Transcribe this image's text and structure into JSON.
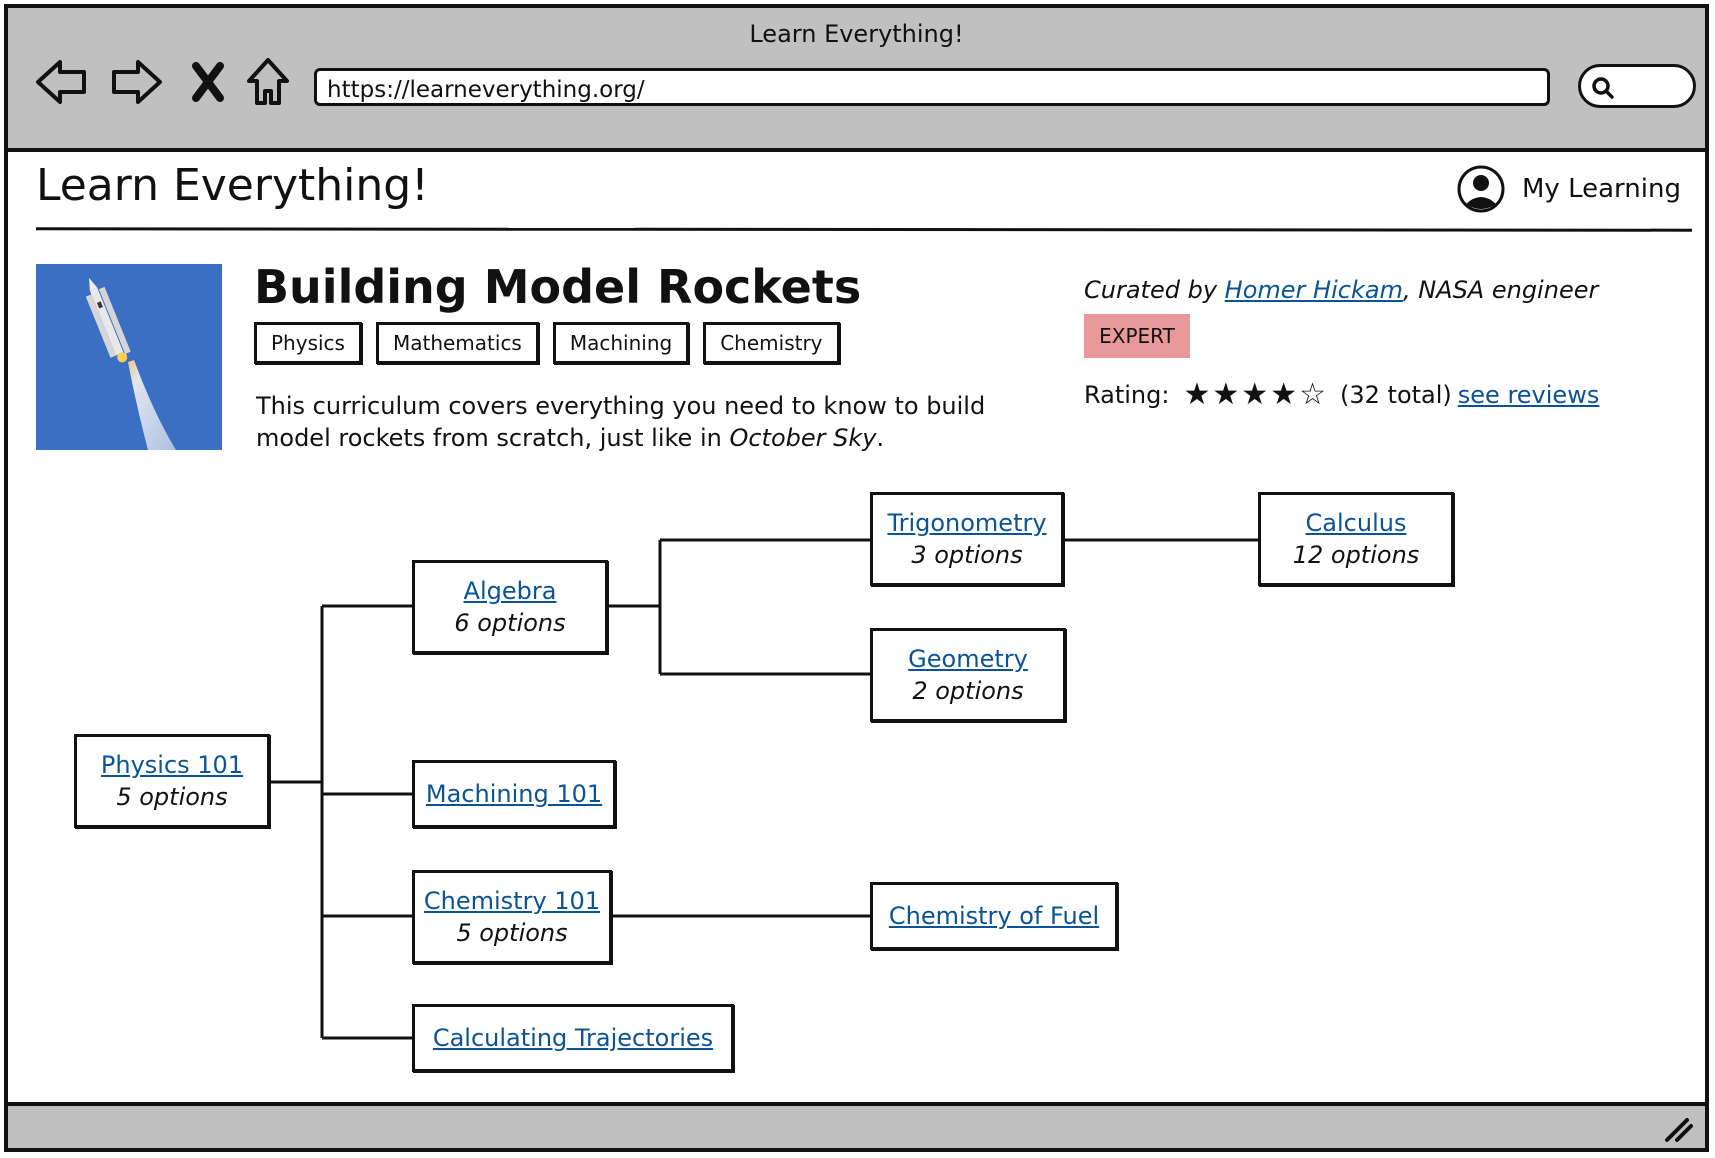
{
  "browser": {
    "window_title": "Learn Everything!",
    "url": "https://learneverything.org/",
    "nav_icons": [
      "back-icon",
      "forward-icon",
      "close-icon",
      "home-icon"
    ],
    "search_icon": "search-icon"
  },
  "header": {
    "site_title": "Learn Everything!",
    "account_label": "My Learning",
    "account_icon": "user-icon"
  },
  "course": {
    "title": "Building Model Rockets",
    "tags": [
      "Physics",
      "Mathematics",
      "Machining",
      "Chemistry"
    ],
    "description_prefix": "This curriculum covers everything you need to know to build model rockets from scratch, just like in ",
    "description_emph": "October Sky",
    "description_suffix": ".",
    "curated_by_label": "Curated by",
    "curator_name": "Homer Hickam",
    "curator_role": ", NASA engineer",
    "level_badge": "EXPERT",
    "level_color": "#e89999",
    "rating_label": "Rating:",
    "rating_value": 4,
    "rating_max": 5,
    "rating_total": "(32 total)",
    "reviews_link": "see reviews"
  },
  "curriculum": {
    "nodes": {
      "physics": {
        "label": "Physics 101",
        "options": "5 options"
      },
      "algebra": {
        "label": "Algebra",
        "options": "6 options"
      },
      "trigonometry": {
        "label": "Trigonometry",
        "options": "3 options"
      },
      "calculus": {
        "label": "Calculus",
        "options": "12 options"
      },
      "geometry": {
        "label": "Geometry",
        "options": "2 options"
      },
      "machining": {
        "label": "Machining 101"
      },
      "chemistry": {
        "label": "Chemistry 101",
        "options": "5 options"
      },
      "fuel": {
        "label": "Chemistry of Fuel"
      },
      "trajectories": {
        "label": "Calculating Trajectories"
      }
    }
  },
  "colors": {
    "link": "#0b5394",
    "chrome": "#c0c0c0",
    "thumbnail_sky": "#3a6fc4"
  }
}
